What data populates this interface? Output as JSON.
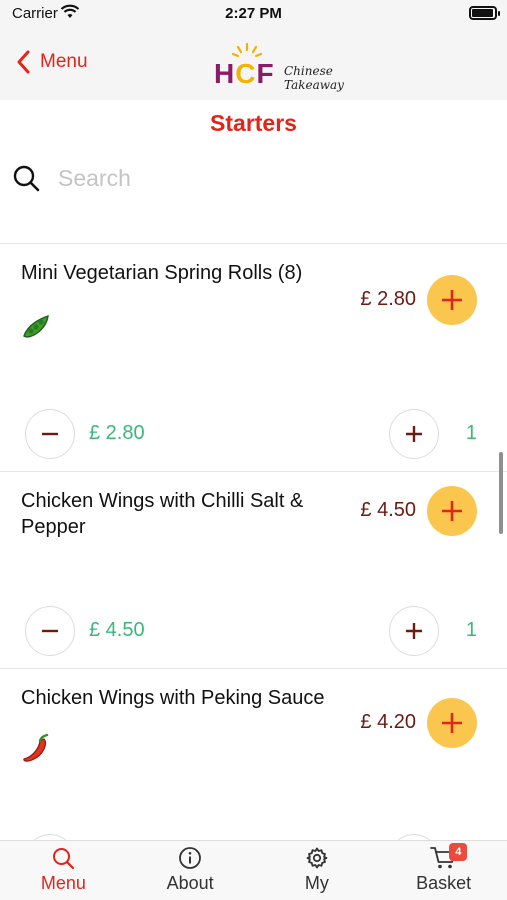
{
  "status": {
    "carrier": "Carrier",
    "time": "2:27 PM"
  },
  "nav": {
    "back_label": "Menu",
    "logo_letters": [
      "H",
      "C",
      "F"
    ],
    "logo_subtitle": "Chinese Takeaway"
  },
  "page_title": "Starters",
  "search": {
    "placeholder": "Search",
    "value": ""
  },
  "items": [
    {
      "name": "Mini Vegetarian Spring Rolls (8)",
      "price": "£ 2.80",
      "icon": "vegetarian-pea-pod-icon",
      "total": "£ 2.80",
      "count": "1"
    },
    {
      "name": "Chicken Wings with Chilli Salt & Pepper",
      "price": "£ 4.50",
      "icon": "",
      "total": "£ 4.50",
      "count": "1"
    },
    {
      "name": "Chicken Wings with Peking Sauce",
      "price": "£ 4.20",
      "icon": "spicy-chilli-icon",
      "total": "",
      "count": ""
    }
  ],
  "tabs": [
    {
      "label": "Menu",
      "icon": "search-icon",
      "active": true
    },
    {
      "label": "About",
      "icon": "info-icon",
      "active": false
    },
    {
      "label": "My",
      "icon": "gear-icon",
      "active": false
    },
    {
      "label": "Basket",
      "icon": "cart-icon",
      "active": false,
      "badge": "4"
    }
  ],
  "colors": {
    "accent": "#e1251b",
    "price": "#6b1b12",
    "green": "#3bb87a",
    "add_button": "#fbc64e"
  }
}
